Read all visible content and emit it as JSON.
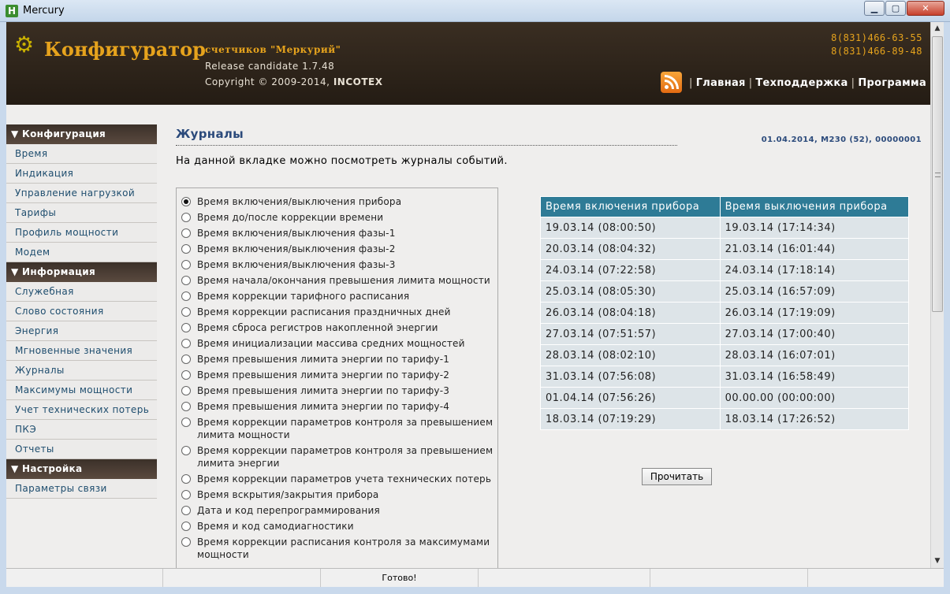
{
  "window": {
    "title": "Mercury",
    "app_icon_letter": "H",
    "min_label": "▁",
    "max_label": "▢",
    "close_label": "✕"
  },
  "header": {
    "brand": "Конфигуратор",
    "subtitle": "счетчиков \"Меркурий\"",
    "release": "Release candidate 1.7.48",
    "copyright_prefix": "Copyright © 2009-2014, ",
    "copyright_company": "INCOTEX",
    "phones": [
      "8(831)466-63-55",
      "8(831)466-89-48"
    ],
    "nav": [
      "Главная",
      "Техподдержка",
      "Программа"
    ],
    "nav_separator": "|",
    "gear_icon": "⚙"
  },
  "sidebar": {
    "sections": [
      {
        "title": "▼ Конфигурация",
        "items": [
          "Время",
          "Индикация",
          "Управление нагрузкой",
          "Тарифы",
          "Профиль мощности",
          "Модем"
        ]
      },
      {
        "title": "▼ Информация",
        "items": [
          "Служебная",
          "Слово состояния",
          "Энергия",
          "Мгновенные значения",
          "Журналы",
          "Максимумы мощности",
          "Учет технических потерь",
          "ПКЭ",
          "Отчеты"
        ]
      },
      {
        "title": "▼ Настройка",
        "items": [
          "Параметры связи"
        ]
      }
    ]
  },
  "main": {
    "title": "Журналы",
    "meta": "01.04.2014, M230 (52), 00000001",
    "intro": "На данной вкладке можно посмотреть журналы событий.",
    "selected_index": 0,
    "options": [
      "Время включения/выключения прибора",
      "Время до/после коррекции времени",
      "Время включения/выключения фазы-1",
      "Время включения/выключения фазы-2",
      "Время включения/выключения фазы-3",
      "Время начала/окончания превышения лимита мощности",
      "Время коррекции тарифного расписания",
      "Время коррекции расписания праздничных дней",
      "Время сброса регистров накопленной энергии",
      "Время инициализации массива средних мощностей",
      "Время превышения лимита энергии по тарифу-1",
      "Время превышения лимита энергии по тарифу-2",
      "Время превышения лимита энергии по тарифу-3",
      "Время превышения лимита энергии по тарифу-4",
      "Время коррекции параметров контроля за превышением лимита мощности",
      "Время коррекции параметров контроля за превышением лимита энергии",
      "Время коррекции параметров учета технических потерь",
      "Время вскрытия/закрытия прибора",
      "Дата и код перепрограммирования",
      "Время и код самодиагностики",
      "Время коррекции расписания контроля за максимумами мощности"
    ],
    "table": {
      "headers": [
        "Время включения прибора",
        "Время выключения прибора"
      ],
      "rows": [
        [
          "19.03.14 (08:00:50)",
          "19.03.14 (17:14:34)"
        ],
        [
          "20.03.14 (08:04:32)",
          "21.03.14 (16:01:44)"
        ],
        [
          "24.03.14 (07:22:58)",
          "24.03.14 (17:18:14)"
        ],
        [
          "25.03.14 (08:05:30)",
          "25.03.14 (16:57:09)"
        ],
        [
          "26.03.14 (08:04:18)",
          "26.03.14 (17:19:09)"
        ],
        [
          "27.03.14 (07:51:57)",
          "27.03.14 (17:00:40)"
        ],
        [
          "28.03.14 (08:02:10)",
          "28.03.14 (16:07:01)"
        ],
        [
          "31.03.14 (07:56:08)",
          "31.03.14 (16:58:49)"
        ],
        [
          "01.04.14 (07:56:26)",
          "00.00.00 (00:00:00)"
        ],
        [
          "18.03.14 (07:19:29)",
          "18.03.14 (17:26:52)"
        ]
      ]
    },
    "read_button": "Прочитать"
  },
  "scrollbar": {
    "up": "▲",
    "down": "▼"
  },
  "statusbar": {
    "cells": [
      "",
      "",
      "Готово!",
      "",
      "",
      ""
    ]
  }
}
